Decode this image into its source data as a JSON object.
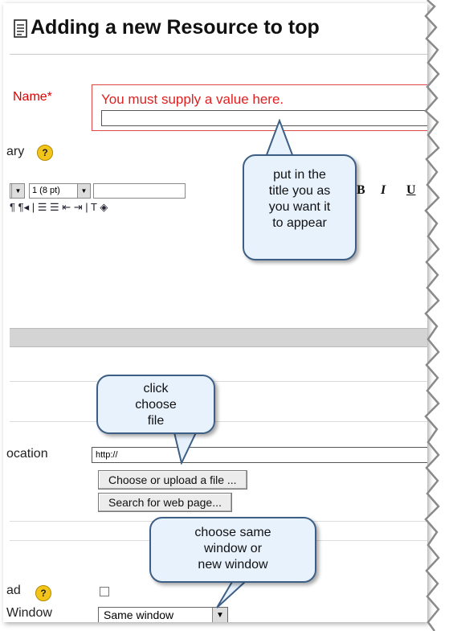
{
  "page": {
    "title": "Adding a new Resource to top"
  },
  "form": {
    "name_label": "Name*",
    "name_error": "You must supply a value here.",
    "summary_label": "ary",
    "help_glyph": "?",
    "location_label": "ocation",
    "location_value": "http://",
    "choose_button": "Choose or upload a file ...",
    "search_button": "Search for web page...",
    "upload_label": "ad",
    "window_label": "Window",
    "window_value": "Same window"
  },
  "editor": {
    "font_size_value": "1 (8 pt)",
    "bold": "B",
    "italic": "I",
    "underline": "U",
    "toolbar_glyphs": "¶ ¶◂ | ☰ ☰ ⇤ ⇥ | T ◈"
  },
  "callouts": {
    "title_tip": [
      "put in the",
      "title you as",
      "you want it",
      "to appear"
    ],
    "file_tip": [
      "click",
      "choose",
      "file"
    ],
    "window_tip": [
      "choose same",
      "window or",
      "new window"
    ]
  },
  "colors": {
    "error": "#e02020",
    "callout_fill": "#e8f2fd",
    "callout_border": "#3d5f86"
  },
  "icons": [
    "document-icon",
    "help-icon",
    "dropdown-arrow-icon"
  ]
}
